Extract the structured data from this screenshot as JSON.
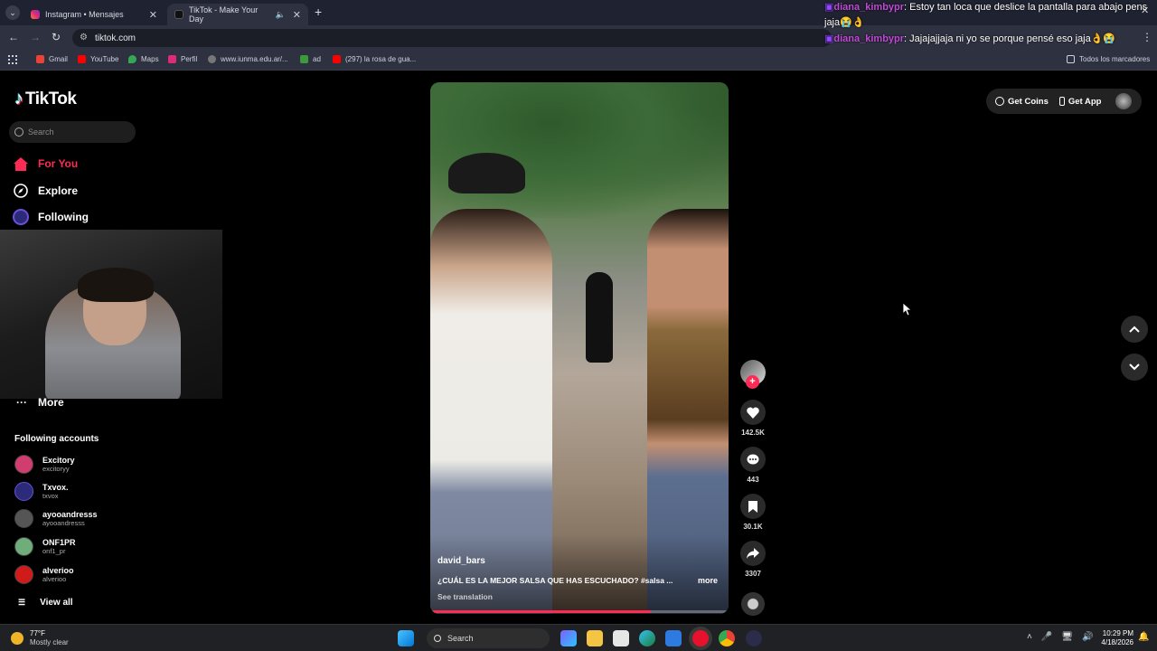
{
  "browser": {
    "tabs": [
      {
        "title": "Instagram • Mensajes",
        "active": false
      },
      {
        "title": "TikTok - Make Your Day",
        "active": true
      }
    ],
    "url": "tiktok.com",
    "bookmarks": [
      "Gmail",
      "YouTube",
      "Maps",
      "Perfil",
      "www.iunma.edu.ar/...",
      "ad",
      "(297) la rosa de gua..."
    ],
    "bookmarks_all": "Todos los marcadores"
  },
  "chat": [
    {
      "user": "diana_kimbypr",
      "text": ": Estoy tan loca que deslice la pantalla para abajo pens",
      "cont": "jaja😭👌"
    },
    {
      "user": "diana_kimbypr",
      "text": ": Jajajajjaja ni yo se porque pensé eso jaja👌😭"
    }
  ],
  "tiktok": {
    "logo": "TikTok",
    "search_placeholder": "Search",
    "nav": [
      {
        "label": "For You",
        "active": true
      },
      {
        "label": "Explore",
        "active": false
      },
      {
        "label": "Following",
        "active": false
      }
    ],
    "more": "More",
    "following_title": "Following accounts",
    "accounts": [
      {
        "name": "Excitory",
        "handle": "excitoryy"
      },
      {
        "name": "Txvox.",
        "handle": "txvox"
      },
      {
        "name": "ayooandresss",
        "handle": "ayooandresss"
      },
      {
        "name": "ONF1PR",
        "handle": "onf1_pr"
      },
      {
        "name": "alverioo",
        "handle": "alverioo"
      }
    ],
    "view_all": "View all",
    "header": {
      "get_coins": "Get Coins",
      "get_app": "Get App"
    },
    "video": {
      "author": "david_bars",
      "caption": "¿CUÁL ES LA MEJOR SALSA QUE HAS ESCUCHADO? #salsa ...",
      "more": "more",
      "see_translation": "See translation",
      "progress": 0.74
    },
    "stats": {
      "likes": "142.5K",
      "comments": "443",
      "saves": "30.1K",
      "shares": "3307"
    }
  },
  "taskbar": {
    "weather_temp": "77°F",
    "weather_text": "Mostly clear",
    "search": "Search",
    "time": "10:29 PM",
    "date": "4/18/2026"
  },
  "colors": {
    "accent": "#fe2c55",
    "chat_user": "#c04ad6"
  }
}
